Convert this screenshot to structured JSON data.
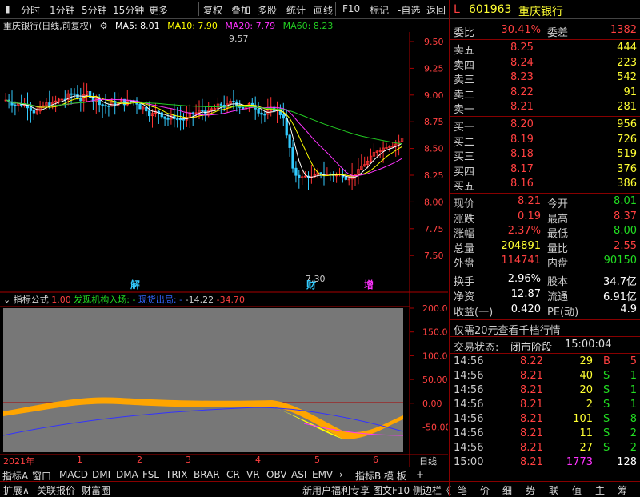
{
  "toolbar": {
    "left_items": [
      "分时",
      "1分钟",
      "5分钟",
      "15分钟",
      "更多"
    ],
    "right_items": [
      "复权",
      "叠加",
      "多股",
      "统计",
      "画线",
      "F10",
      "标记",
      "-自选",
      "返回"
    ]
  },
  "stock": {
    "code": "601963",
    "name": "重庆银行",
    "badge": "L"
  },
  "info": {
    "title": "重庆银行(日线,前复权)",
    "ma5": "MA5: 8.01",
    "ma10": "MA10: 7.90",
    "ma20": "MA20: 7.79",
    "ma60": "MA60: 8.23",
    "colors": {
      "ma5": "#ffffff",
      "ma10": "#ffff00",
      "ma20": "#ff33ff",
      "ma60": "#22cc22"
    }
  },
  "price_axis": [
    "9.50",
    "9.25",
    "9.00",
    "8.75",
    "8.50",
    "8.25",
    "8.00",
    "7.75",
    "7.50"
  ],
  "annotations": {
    "high": "9.57",
    "low": "7.30",
    "marks": [
      "解",
      "财",
      "增"
    ]
  },
  "indicator": {
    "title": "指标公式",
    "p1": "1.00",
    "p2": "发现机构入场:",
    "p2v": "-",
    "p3": "现货出局:",
    "p3v": "-",
    "p4": "-14.22",
    "p5": "-34.70",
    "axis": [
      "200.00",
      "150.00",
      "100.00",
      "50.00",
      "0.00",
      "-50.00"
    ]
  },
  "time_axis": {
    "year": "2021年",
    "months": [
      "1",
      "2",
      "3",
      "4",
      "5",
      "6"
    ],
    "right": "日线"
  },
  "indicator_tabs": [
    "指标A",
    "窗口",
    "MACD",
    "DMI",
    "DMA",
    "FSL",
    "TRIX",
    "BRAR",
    "CR",
    "VR",
    "OBV",
    "ASI",
    "EMV"
  ],
  "indicator_right": [
    "指标B",
    "模 板",
    "+",
    "-"
  ],
  "bottom_left": [
    "扩展∧",
    "关联报价",
    "财富圈"
  ],
  "bottom_mid": [
    "新用户福利专享",
    "图文F10",
    "侧边栏《"
  ],
  "bottom_right": [
    "笔",
    "价",
    "细",
    "势",
    "联",
    "值",
    "主",
    "筹"
  ],
  "weibi": {
    "label": "委比",
    "value": "30.41%",
    "label2": "委差",
    "value2": "1382"
  },
  "sells": [
    {
      "label": "卖五",
      "price": "8.25",
      "vol": "444"
    },
    {
      "label": "卖四",
      "price": "8.24",
      "vol": "223"
    },
    {
      "label": "卖三",
      "price": "8.23",
      "vol": "542"
    },
    {
      "label": "卖二",
      "price": "8.22",
      "vol": "91"
    },
    {
      "label": "卖一",
      "price": "8.21",
      "vol": "281"
    }
  ],
  "buys": [
    {
      "label": "买一",
      "price": "8.20",
      "vol": "956"
    },
    {
      "label": "买二",
      "price": "8.19",
      "vol": "726"
    },
    {
      "label": "买三",
      "price": "8.18",
      "vol": "519"
    },
    {
      "label": "买四",
      "price": "8.17",
      "vol": "376"
    },
    {
      "label": "买五",
      "price": "8.16",
      "vol": "386"
    }
  ],
  "stats": [
    {
      "l": "现价",
      "v": "8.21",
      "l2": "今开",
      "v2": "8.01"
    },
    {
      "l": "涨跌",
      "v": "0.19",
      "l2": "最高",
      "v2": "8.37"
    },
    {
      "l": "涨幅",
      "v": "2.37%",
      "l2": "最低",
      "v2": "8.00"
    },
    {
      "l": "总量",
      "v": "204891",
      "l2": "量比",
      "v2": "2.55"
    },
    {
      "l": "外盘",
      "v": "114741",
      "l2": "内盘",
      "v2": "90150"
    }
  ],
  "stats2": [
    {
      "l": "换手",
      "v": "2.96%",
      "l2": "股本",
      "v2": "34.7亿"
    },
    {
      "l": "净资",
      "v": "12.87",
      "l2": "流通",
      "v2": "6.91亿"
    },
    {
      "l": "收益(一)",
      "v": "0.420",
      "l2": "PE(动)",
      "v2": "4.9"
    }
  ],
  "promo": "仅需20元查看千档行情",
  "trade_status": {
    "label": "交易状态:",
    "value": "闭市阶段",
    "time": "15:00:04"
  },
  "ticks": [
    {
      "t": "14:56",
      "p": "8.22",
      "v": "29",
      "d": "B",
      "n": "5"
    },
    {
      "t": "14:56",
      "p": "8.21",
      "v": "40",
      "d": "S",
      "n": "1"
    },
    {
      "t": "14:56",
      "p": "8.21",
      "v": "20",
      "d": "S",
      "n": "1"
    },
    {
      "t": "14:56",
      "p": "8.21",
      "v": "2",
      "d": "S",
      "n": "1"
    },
    {
      "t": "14:56",
      "p": "8.21",
      "v": "101",
      "d": "S",
      "n": "8"
    },
    {
      "t": "14:56",
      "p": "8.21",
      "v": "11",
      "d": "S",
      "n": "2"
    },
    {
      "t": "14:56",
      "p": "8.21",
      "v": "27",
      "d": "S",
      "n": "2"
    },
    {
      "t": "15:00",
      "p": "8.21",
      "v": "1773",
      "d": "",
      "n": "128"
    }
  ]
}
